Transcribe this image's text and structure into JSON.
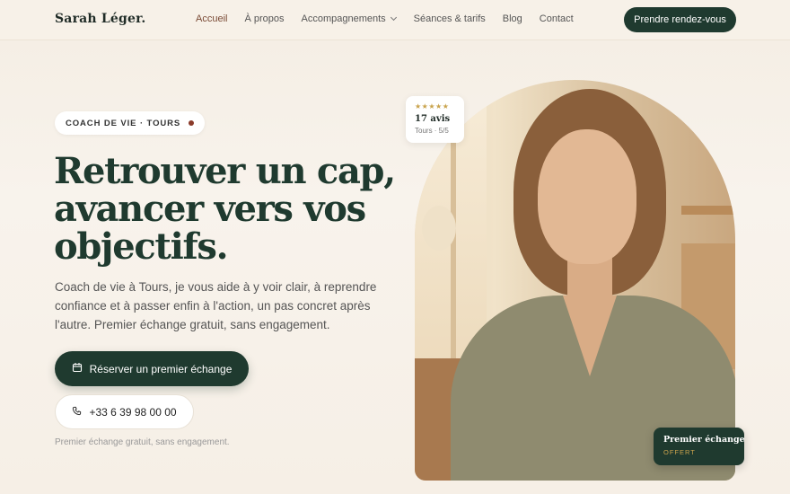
{
  "header": {
    "brand": "Sarah Léger.",
    "nav": [
      {
        "label": "Accueil",
        "active": true
      },
      {
        "label": "À propos"
      },
      {
        "label": "Accompagnements",
        "dropdown": true
      },
      {
        "label": "Séances & tarifs"
      },
      {
        "label": "Blog"
      },
      {
        "label": "Contact"
      }
    ],
    "cta": "Prendre rendez-vous"
  },
  "hero": {
    "badge": "COACH DE VIE · TOURS",
    "headline_lines": [
      "Retrouver un cap,",
      "avancer vers vos",
      "objectifs."
    ],
    "intro": "Coach de vie à Tours, je vous aide à y voir clair, à reprendre confiance et à passer enfin à l'action, un pas concret après l'autre. Premier échange gratuit, sans engagement.",
    "primary_button": "Réserver un premier échange",
    "phone_button": "+33 6 39 98 00 00",
    "note": "Premier échange gratuit, sans engagement."
  },
  "rating_card": {
    "stars": "★★★★★",
    "count": "17 avis",
    "location": "Tours · 5/5"
  },
  "offer_card": {
    "title": "Premier échange",
    "subtitle": "OFFERT"
  },
  "colors": {
    "accent": "#1f3a2f",
    "active_nav": "#7a4a35",
    "star": "#c9a34c",
    "badge_dot": "#8a3a2a"
  },
  "icons": {
    "primary_button": "calendar-icon",
    "phone_button": "phone-icon",
    "nav_dropdown": "chevron-down-icon"
  }
}
